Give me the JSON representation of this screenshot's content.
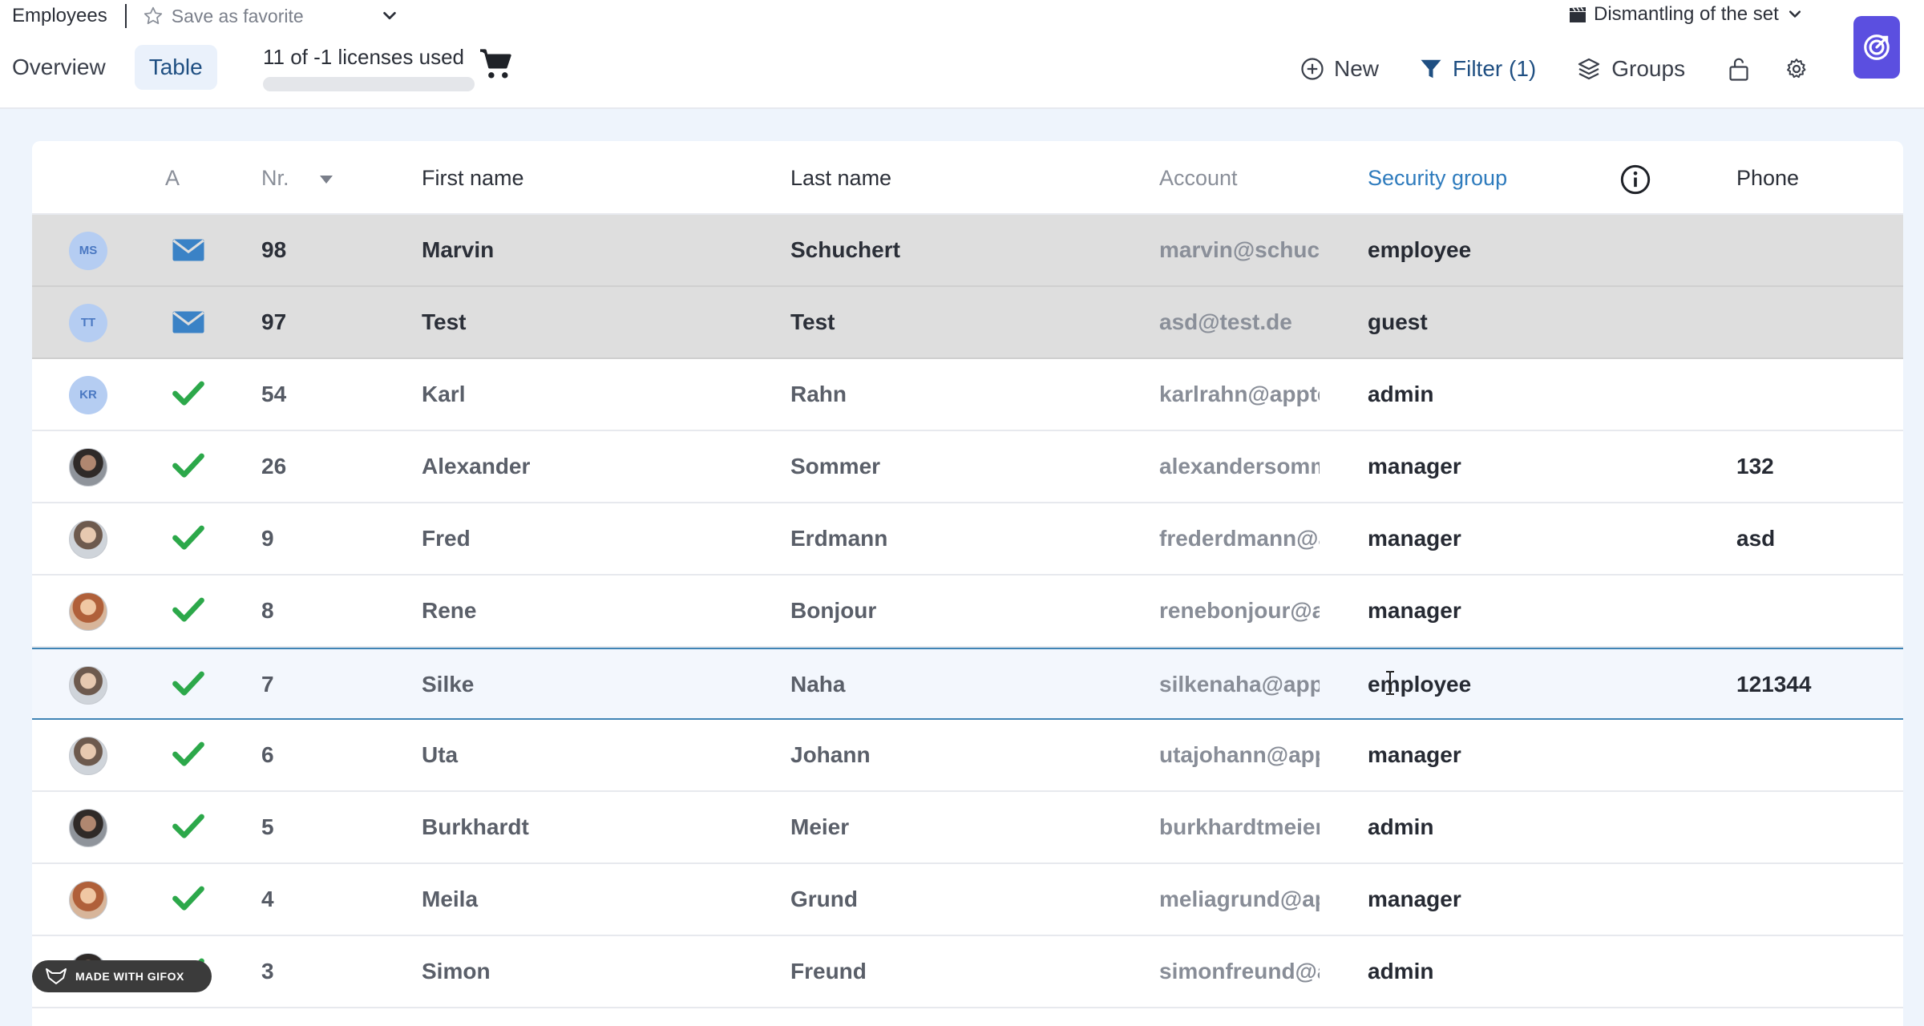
{
  "header": {
    "breadcrumb": "Employees",
    "favorite_label": "Save as favorite",
    "set_label": "Dismantling of the set",
    "tabs": [
      {
        "label": "Overview",
        "active": false
      },
      {
        "label": "Table",
        "active": true
      }
    ],
    "license_text": "11 of -1 licenses used",
    "toolbar": {
      "new_label": "New",
      "filter_label": "Filter (1)",
      "groups_label": "Groups"
    }
  },
  "table": {
    "columns": {
      "active": "A",
      "nr": "Nr.",
      "first_name": "First name",
      "last_name": "Last name",
      "account": "Account",
      "security_group": "Security group",
      "phone": "Phone"
    },
    "rows": [
      {
        "avatar": "MS",
        "status": "mail-icon",
        "nr": "98",
        "first": "Marvin",
        "last": "Schuchert",
        "account": "marvin@schuch",
        "group": "employee",
        "phone": ""
      },
      {
        "avatar": "TT",
        "status": "mail-icon",
        "nr": "97",
        "first": "Test",
        "last": "Test",
        "account": "asd@test.de",
        "group": "guest",
        "phone": ""
      },
      {
        "avatar": "KR",
        "status": "check-icon",
        "nr": "54",
        "first": "Karl",
        "last": "Rahn",
        "account": "karlrahn@appte",
        "group": "admin",
        "phone": ""
      },
      {
        "avatar": "",
        "status": "check-icon",
        "nr": "26",
        "first": "Alexander",
        "last": "Sommer",
        "account": "alexandersomm",
        "group": "manager",
        "phone": "132"
      },
      {
        "avatar": "",
        "status": "check-icon",
        "nr": "9",
        "first": "Fred",
        "last": "Erdmann",
        "account": "frederdmann@a",
        "group": "manager",
        "phone": "asd"
      },
      {
        "avatar": "",
        "status": "check-icon",
        "nr": "8",
        "first": "Rene",
        "last": "Bonjour",
        "account": "renebonjour@a",
        "group": "manager",
        "phone": ""
      },
      {
        "avatar": "",
        "status": "check-icon",
        "nr": "7",
        "first": "Silke",
        "last": "Naha",
        "account": "silkenaha@app",
        "group": "employee",
        "phone": "121344"
      },
      {
        "avatar": "",
        "status": "check-icon",
        "nr": "6",
        "first": "Uta",
        "last": "Johann",
        "account": "utajohann@app",
        "group": "manager",
        "phone": ""
      },
      {
        "avatar": "",
        "status": "check-icon",
        "nr": "5",
        "first": "Burkhardt",
        "last": "Meier",
        "account": "burkhardtmeier",
        "group": "admin",
        "phone": ""
      },
      {
        "avatar": "",
        "status": "check-icon",
        "nr": "4",
        "first": "Meila",
        "last": "Grund",
        "account": "meliagrund@ap",
        "group": "manager",
        "phone": ""
      },
      {
        "avatar": "",
        "status": "check-icon",
        "nr": "3",
        "first": "Simon",
        "last": "Freund",
        "account": "simonfreund@a",
        "group": "admin",
        "phone": ""
      }
    ]
  },
  "watermark": "MADE WITH GIFOX",
  "colors": {
    "accent": "#1f4f82",
    "link_blue": "#2e7bbd",
    "check_green": "#2ca84a",
    "mail_blue": "#3a82c6",
    "app_button": "#5b4fe0"
  }
}
